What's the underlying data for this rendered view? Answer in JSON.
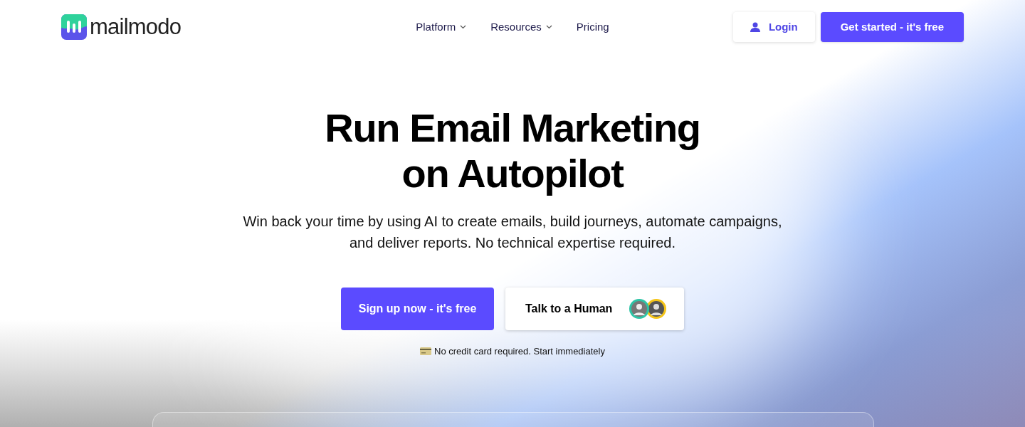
{
  "header": {
    "logo": "mailmodo",
    "nav": [
      {
        "label": "Platform",
        "dropdown": true
      },
      {
        "label": "Resources",
        "dropdown": true
      },
      {
        "label": "Pricing",
        "dropdown": false
      }
    ],
    "login": "Login",
    "cta": "Get started - it's free"
  },
  "hero": {
    "title_lines": [
      "Run Email Marketing",
      "on Autopilot"
    ],
    "subtitle": "Win back your time by using AI to create emails, build journeys, automate campaigns, and deliver reports. No technical expertise required.",
    "primary": "Sign up now - it's free",
    "secondary": "Talk to a Human",
    "note": "No credit card required. Start immediately"
  }
}
